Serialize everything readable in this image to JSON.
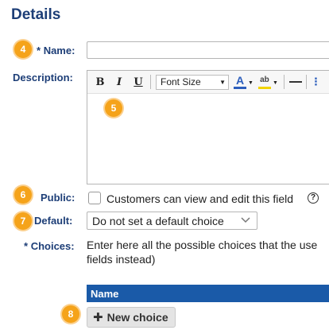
{
  "section_title": "Details",
  "badges": {
    "name": "4",
    "editor": "5",
    "public": "6",
    "default": "7",
    "new_choice": "8"
  },
  "name_field": {
    "required_marker": "*",
    "label": "Name:",
    "value": ""
  },
  "description": {
    "label": "Description:",
    "toolbar": {
      "bold": "B",
      "italic": "I",
      "underline": "U",
      "font_select": "Font Size",
      "font_color_glyph": "A",
      "highlight_glyph": "ab",
      "font_color": "#2c5ebc",
      "highlight_color": "#f2d400"
    }
  },
  "public": {
    "label": "Public:",
    "checkbox_text": "Customers can view and edit this field",
    "checked": false
  },
  "default_choice": {
    "label": "Default:",
    "selected": "Do not set a default choice"
  },
  "choices": {
    "required_marker": "*",
    "label": "Choices:",
    "help_line1": "Enter here all the possible choices that the use",
    "help_line2": "fields instead)",
    "table_header": "Name",
    "new_choice_button": "New choice"
  },
  "colors": {
    "label_navy": "#1d3e77",
    "badge_orange": "#f5a31a",
    "header_blue": "#1a5aa8"
  }
}
